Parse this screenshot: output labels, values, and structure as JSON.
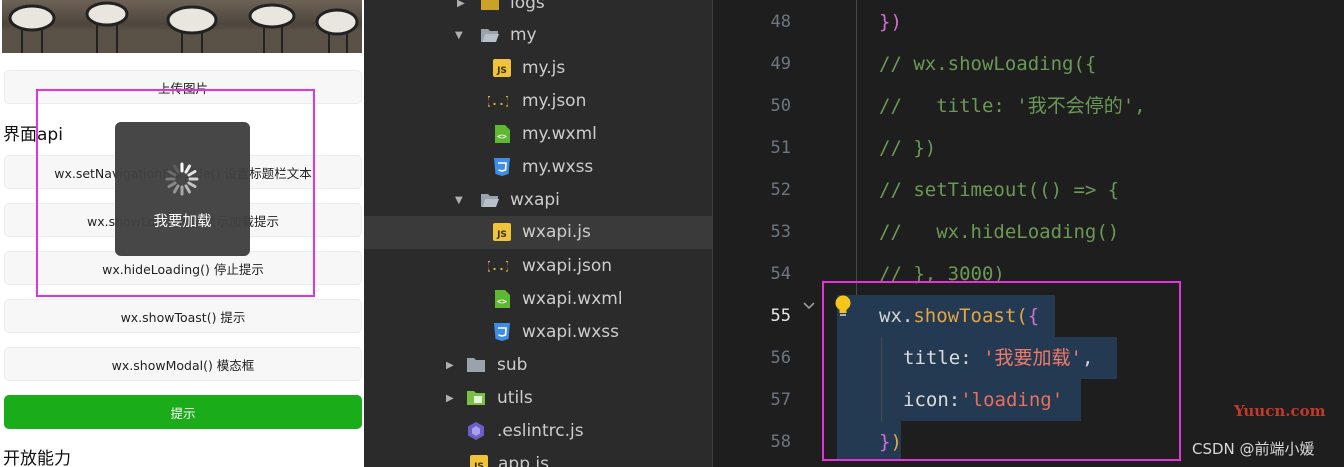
{
  "simulator": {
    "buttons": {
      "upload": "上传图片",
      "set_nav": "wx.setNavigationBarTitle() 设置标题栏文本",
      "show_loading": "wx.showLoading() 显示加载提示",
      "hide_loading": "wx.hideLoading() 停止提示",
      "show_toast": "wx.showToast() 提示",
      "show_modal": "wx.showModal() 模态框",
      "tip": "提示"
    },
    "sections": {
      "ui": "界面api",
      "open": "开放能力"
    },
    "toast": {
      "title": "我要加载",
      "icon": "loading-spinner-icon"
    }
  },
  "explorer": {
    "rows": [
      {
        "label": "logs",
        "kind": "folder",
        "expanded": false,
        "icon": "folder-icon"
      },
      {
        "label": "my",
        "kind": "folder",
        "expanded": true,
        "icon": "folder-open-icon"
      },
      {
        "label": "my.js",
        "kind": "file",
        "icon": "js-file-icon"
      },
      {
        "label": "my.json",
        "kind": "file",
        "icon": "json-file-icon"
      },
      {
        "label": "my.wxml",
        "kind": "file",
        "icon": "wxml-file-icon"
      },
      {
        "label": "my.wxss",
        "kind": "file",
        "icon": "css-file-icon"
      },
      {
        "label": "wxapi",
        "kind": "folder",
        "expanded": true,
        "icon": "folder-open-icon"
      },
      {
        "label": "wxapi.js",
        "kind": "file",
        "icon": "js-file-icon",
        "selected": true
      },
      {
        "label": "wxapi.json",
        "kind": "file",
        "icon": "json-file-icon"
      },
      {
        "label": "wxapi.wxml",
        "kind": "file",
        "icon": "wxml-file-icon"
      },
      {
        "label": "wxapi.wxss",
        "kind": "file",
        "icon": "css-file-icon"
      },
      {
        "label": "sub",
        "kind": "folder",
        "expanded": false,
        "icon": "folder-icon"
      },
      {
        "label": "utils",
        "kind": "folder",
        "expanded": false,
        "icon": "folder-plus-icon"
      },
      {
        "label": ".eslintrc.js",
        "kind": "file",
        "icon": "eslint-file-icon"
      },
      {
        "label": "app.js",
        "kind": "file",
        "icon": "js-file-icon"
      }
    ]
  },
  "editor": {
    "active_line": "55",
    "lines": [
      {
        "n": "48",
        "text": "})"
      },
      {
        "n": "49",
        "text": "// wx.showLoading({"
      },
      {
        "n": "50",
        "text": "//   title: '我不会停的',"
      },
      {
        "n": "51",
        "text": "// })"
      },
      {
        "n": "52",
        "text": "// setTimeout(() => {"
      },
      {
        "n": "53",
        "text": "//   wx.hideLoading()"
      },
      {
        "n": "54",
        "text": "// }, 3000)"
      },
      {
        "n": "55",
        "text": "wx.showToast({"
      },
      {
        "n": "56",
        "text": "title: '我要加载',"
      },
      {
        "n": "57",
        "text": "icon:'loading'"
      },
      {
        "n": "58",
        "text": "})"
      }
    ],
    "tokens": {
      "l48_close": "})",
      "l49": "// wx.showLoading({",
      "l50": "//   title: '我不会停的',",
      "l51": "// })",
      "l52": "// setTimeout(() => {",
      "l53": "//   wx.hideLoading()",
      "l54": "// }, 3000)",
      "l55_obj": "wx",
      "l55_dot": ".",
      "l55_fn": "showToast",
      "l55_paren": "(",
      "l55_brace": "{",
      "l56_key": "title",
      "l56_colon": ": ",
      "l56_str": "'我要加载'",
      "l56_comma": ",",
      "l57_key": "icon",
      "l57_colon": ":",
      "l57_str": "'loading'",
      "l58_brace": "}",
      "l58_paren": ")"
    }
  },
  "watermarks": {
    "site": "Yuucn.com",
    "csdn": "CSDN @前端小媛"
  },
  "colors": {
    "highlight_border": "#e234d8",
    "primary_button": "#1aad19",
    "comment": "#6a9955",
    "string": "#f07a6a",
    "function": "#e5a545"
  }
}
